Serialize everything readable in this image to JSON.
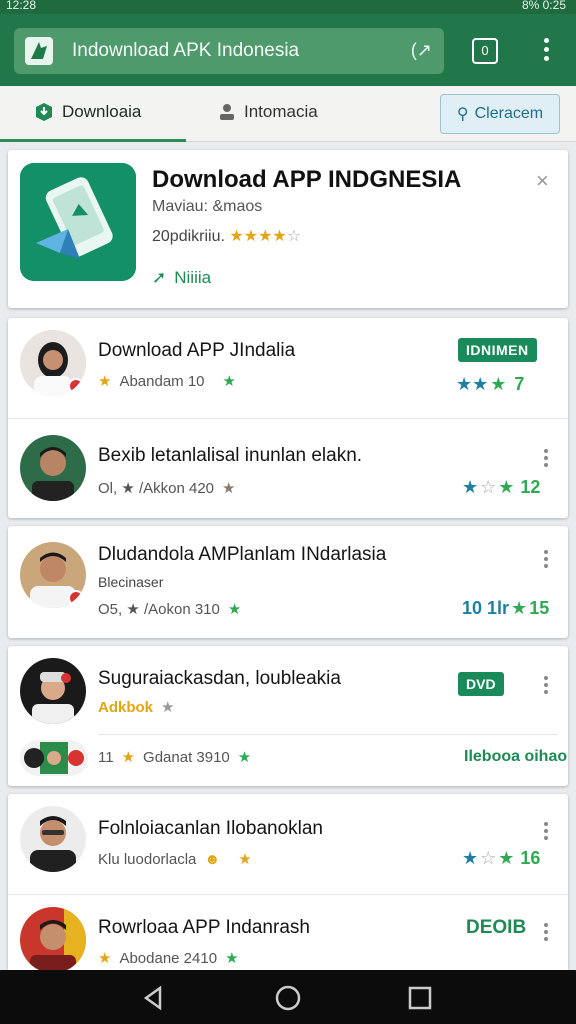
{
  "status": {
    "time": "12:28",
    "right": "8% 0:25"
  },
  "browser": {
    "url_title": "Indownload APK Indonesia",
    "tab_count": "0"
  },
  "tabs": [
    {
      "label": "Downloaia"
    },
    {
      "label": "Intomacia"
    }
  ],
  "clear_button": "Cleracem",
  "featured": {
    "title": "Download APP INDGNESIA",
    "subtitle": "Maviau: &maos",
    "rating_label": "20pdikriiu.",
    "action_label": "Niiiia"
  },
  "items": [
    {
      "title": "Download APP JIndalia",
      "meta": "Abandam 10",
      "tag": "IDNIMEN",
      "score": "7"
    },
    {
      "title": "Bexib letanlalisal inunlan elakn.",
      "meta": "Ol, ★ /Akkon 420",
      "score": "12"
    },
    {
      "title": "Dludandola AMPlanlam INdarlasia",
      "extra": "Blecinaser",
      "meta": "O5, ★ /Aokon 310",
      "score_label": "10 1lr",
      "score": "15"
    },
    {
      "title": "Suguraiackasdan, loubleakia",
      "meta_label": "Adkbok",
      "tag": "DVD",
      "sub_meta": "11",
      "sub_meta2": "Gdanat 3910",
      "sub_action": "Ilebooa oihao"
    },
    {
      "title": "Folnloiacanlan Ilobanoklan",
      "meta": "Klu luodorlacla",
      "score": "16"
    },
    {
      "title": "Rowrloaa APP Indanrash",
      "meta": "Abodane 2410",
      "tag": "DEOIB"
    }
  ]
}
